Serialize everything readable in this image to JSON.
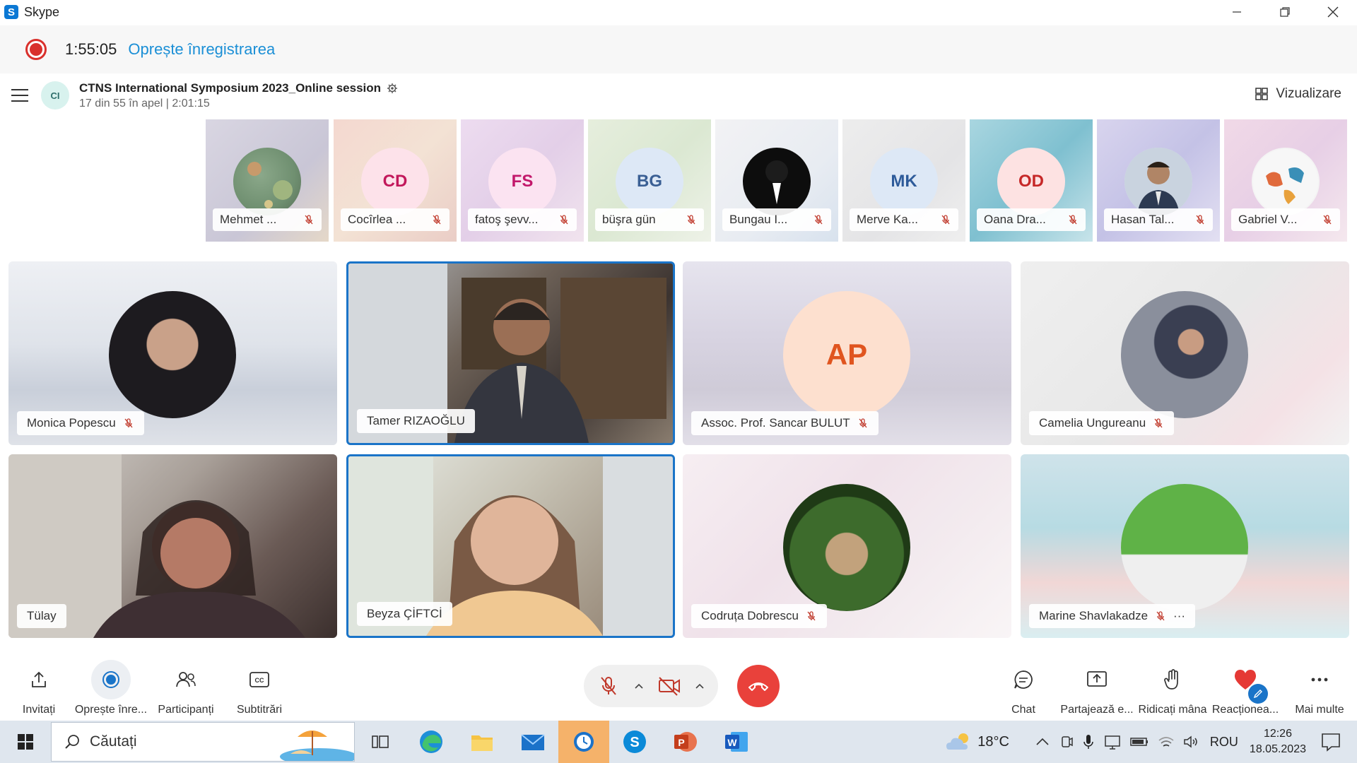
{
  "window": {
    "app_title": "Skype"
  },
  "recording": {
    "time": "1:55:05",
    "stop_label": "Oprește înregistrarea"
  },
  "call": {
    "avatar_initials": "CI",
    "title": "CTNS International Symposium 2023_Online session",
    "subtitle": "17 din 55 în apel | 2:01:15",
    "view_label": "Vizualizare"
  },
  "strip": [
    {
      "name": "Mehmet ...",
      "initials": "",
      "kind": "photo-planets"
    },
    {
      "name": "Cocîrlea ...",
      "initials": "CD",
      "kind": "initials"
    },
    {
      "name": "fatoş şevv...",
      "initials": "FS",
      "kind": "initials"
    },
    {
      "name": "büşra gün",
      "initials": "BG",
      "kind": "initials"
    },
    {
      "name": "Bungau I...",
      "initials": "",
      "kind": "photo-dark"
    },
    {
      "name": "Merve Ka...",
      "initials": "MK",
      "kind": "initials"
    },
    {
      "name": "Oana Dra...",
      "initials": "OD",
      "kind": "initials"
    },
    {
      "name": "Hasan Tal...",
      "initials": "",
      "kind": "photo-man"
    },
    {
      "name": "Gabriel V...",
      "initials": "",
      "kind": "photo-map"
    }
  ],
  "grid": [
    {
      "name": "Monica Popescu",
      "muted": true
    },
    {
      "name": "Tamer RIZAOĞLU",
      "muted": false
    },
    {
      "name": "Assoc. Prof. Sancar BULUT",
      "muted": true,
      "initials": "AP"
    },
    {
      "name": "Camelia Ungureanu",
      "muted": true
    },
    {
      "name": "Tülay",
      "muted": false
    },
    {
      "name": "Beyza ÇİFTCİ",
      "muted": false
    },
    {
      "name": "Codruța Dobrescu",
      "muted": true
    },
    {
      "name": "Marine Shavlakadze",
      "muted": true,
      "more": "···"
    }
  ],
  "toolbar": {
    "invite": "Invitați",
    "stop_rec": "Oprește înre...",
    "participants": "Participanți",
    "subtitles": "Subtitrări",
    "chat": "Chat",
    "share": "Partajează e...",
    "raise_hand": "Ridicați mâna",
    "react": "Reacționea...",
    "more": "Mai multe"
  },
  "taskbar": {
    "search_placeholder": "Căutați",
    "temperature": "18°C",
    "language": "ROU",
    "time": "12:26",
    "date": "18.05.2023"
  },
  "colors": {
    "accent": "#1a74c8",
    "record": "#d9302c",
    "end_call": "#e9413b",
    "link": "#1b8fd6"
  }
}
